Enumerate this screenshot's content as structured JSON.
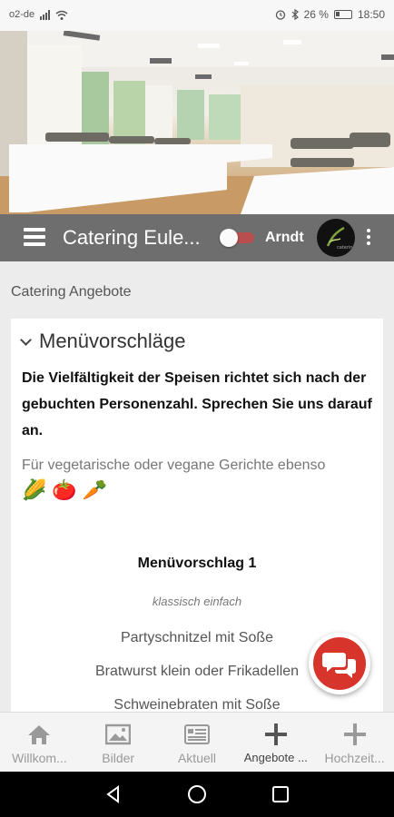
{
  "status": {
    "carrier": "o2-de",
    "battery_text": "26 %",
    "time": "18:50"
  },
  "hero": {
    "image": "catering-buffet-hall"
  },
  "appbar": {
    "title": "Catering Eule...",
    "toggle_on": false,
    "user_name": "Arndt"
  },
  "page": {
    "section_label": "Catering Angebote"
  },
  "card": {
    "title": "Menüvorschläge",
    "intro": "Die Vielfältigkeit der Speisen richtet sich nach der gebuchten Personenzahl. Sprechen Sie uns darauf an.",
    "note": "Für vegetarische oder vegane Gerichte ebenso",
    "emojis": [
      "🌽",
      "🍅",
      "🥕"
    ],
    "menu_title": "Menüvorschlag 1",
    "menu_subtitle": "klassisch einfach",
    "menu_items": [
      "Partyschnitzel mit Soße",
      "Bratwurst klein oder Frikadellen",
      "Schweinebraten mit Soße"
    ]
  },
  "bottom_nav": [
    {
      "label": "Willkom...",
      "icon": "home-icon"
    },
    {
      "label": "Bilder",
      "icon": "image-icon"
    },
    {
      "label": "Aktuell",
      "icon": "news-icon"
    },
    {
      "label": "Angebote ...",
      "icon": "plus-icon",
      "active": true
    },
    {
      "label": "Hochzeit...",
      "icon": "plus-icon"
    }
  ],
  "colors": {
    "appbar": "#6e6e6e",
    "fab": "#d7342b",
    "toggle_track": "#b84e4e"
  }
}
